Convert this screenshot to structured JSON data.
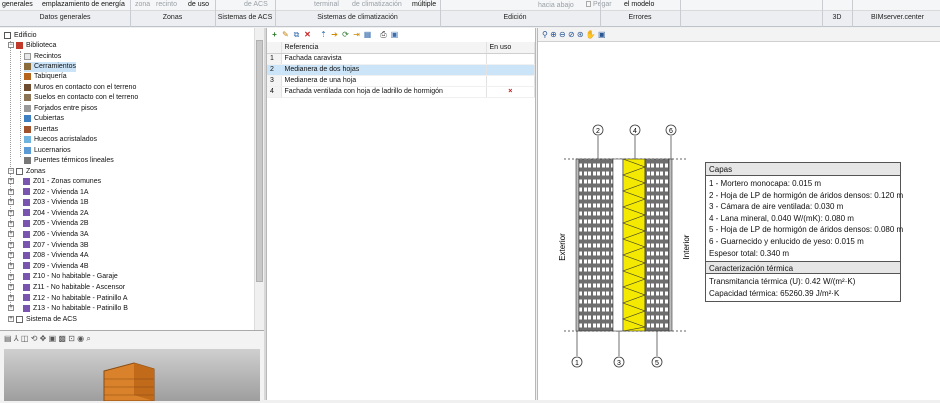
{
  "ribbon": {
    "row1": {
      "generales": "generales",
      "emplazamiento": "emplazamiento de energía",
      "zona": "zona",
      "recinto": "recinto",
      "de_uso": "de uso",
      "de_acs": "de ACS",
      "terminal": "terminal",
      "de_climatizacion": "de climatización",
      "multiple": "múltiple",
      "hacia_abajo": "hacia abajo",
      "pegar": "Pegar",
      "el_modelo": "el modelo"
    },
    "groups": {
      "datos_generales": "Datos generales",
      "zonas": "Zonas",
      "sistemas_acs": "Sistemas de ACS",
      "sistemas_climatizacion": "Sistemas de climatización",
      "edicion": "Edición",
      "errores": "Errores",
      "tres_d": "3D",
      "bimserver": "BIMserver.center"
    }
  },
  "tree": {
    "root": "Edificio",
    "biblioteca": "Biblioteca",
    "library_items": [
      "Recintos",
      "Cerramientos",
      "Tabiquería",
      "Muros en contacto con el terreno",
      "Suelos en contacto con el terreno",
      "Forjados entre pisos",
      "Cubiertas",
      "Puertas",
      "Huecos acristalados",
      "Lucernarios",
      "Puentes térmicos lineales"
    ],
    "zonas": "Zonas",
    "zone_items": [
      "Z01 - Zonas comunes",
      "Z02 - Vivienda 1A",
      "Z03 - Vivienda 1B",
      "Z04 - Vivienda 2A",
      "Z05 - Vivienda 2B",
      "Z06 - Vivienda 3A",
      "Z07 - Vivienda 3B",
      "Z08 - Vivienda 4A",
      "Z09 - Vivienda 4B",
      "Z10 - No habitable - Garaje",
      "Z11 - No habitable - Ascensor",
      "Z12 - No habitable - Patinillo A",
      "Z13 - No habitable - Patinillo B"
    ],
    "sistema_acs": "Sistema de ACS"
  },
  "list": {
    "headers": [
      "Referencia",
      "En uso"
    ],
    "rows": [
      {
        "num": "1",
        "ref": "Fachada caravista",
        "en_uso": ""
      },
      {
        "num": "2",
        "ref": "Medianera de dos hojas",
        "en_uso": ""
      },
      {
        "num": "3",
        "ref": "Medianera de una hoja",
        "en_uso": ""
      },
      {
        "num": "4",
        "ref": "Fachada ventilada con hoja de ladrillo de hormigón",
        "en_uso": "×"
      }
    ],
    "selected_index": 1
  },
  "diagram": {
    "side_left": "Exterior",
    "side_right": "Interior",
    "top_markers": [
      "2",
      "4",
      "6"
    ],
    "bottom_markers": [
      "1",
      "3",
      "5"
    ]
  },
  "properties": {
    "capas_title": "Capas",
    "capas": [
      "1 - Mortero monocapa: 0.015 m",
      "2 - Hoja de LP de hormigón de áridos densos: 0.120 m",
      "3 - Cámara de aire ventilada: 0.030 m",
      "4 - Lana mineral, 0.040 W/(mK): 0.080 m",
      "5 - Hoja de LP de hormigón de áridos densos: 0.080 m",
      "6 - Guarnecido y enlucido de yeso: 0.015 m",
      "Espesor total: 0.340 m"
    ],
    "caract_title": "Caracterización térmica",
    "caract": [
      "Transmitancia térmica (U): 0.42 W/(m²·K)",
      "Capacidad térmica: 65260.39 J/m²·K"
    ]
  },
  "colors": {
    "selection": "#cce4f7",
    "insulation": "#f4e900",
    "brick": "#7a7a7a",
    "ribbon_bg": "#eceef1"
  }
}
